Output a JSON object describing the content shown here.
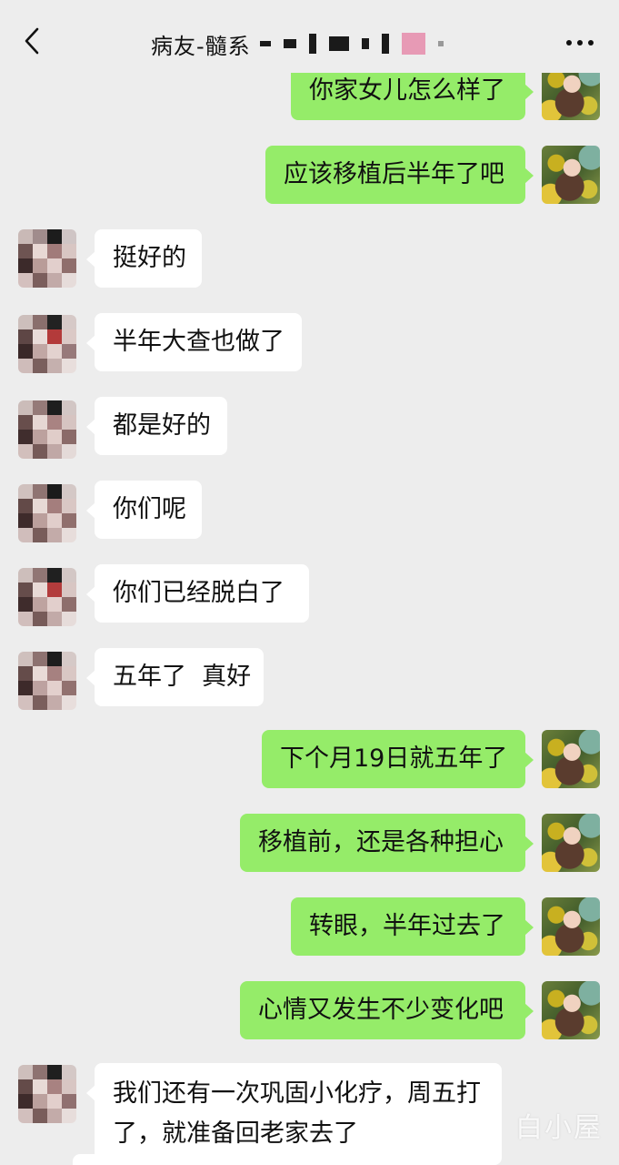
{
  "header": {
    "title": "病友-髓系"
  },
  "messages": [
    {
      "side": "right",
      "text": "你家女儿怎么样了"
    },
    {
      "side": "right",
      "text": "应该移植后半年了吧"
    },
    {
      "side": "left",
      "text": "挺好的"
    },
    {
      "side": "left",
      "text": "半年大查也做了"
    },
    {
      "side": "left",
      "text": "都是好的"
    },
    {
      "side": "left",
      "text": "你们呢"
    },
    {
      "side": "left",
      "text": "你们已经脱白了"
    },
    {
      "side": "left",
      "text": "五年了  真好"
    },
    {
      "side": "right",
      "text": "下个月19日就五年了"
    },
    {
      "side": "right",
      "text": "移植前，还是各种担心"
    },
    {
      "side": "right",
      "text": "转眼，半年过去了"
    },
    {
      "side": "right",
      "text": "心情又发生不少变化吧"
    },
    {
      "side": "left",
      "text": "我们还有一次巩固小化疗，周五打了，就准备回老家去了"
    }
  ],
  "watermark": "白小屋",
  "icons": {
    "back": "chevron-left-icon",
    "more": "more-dots-icon"
  },
  "colors": {
    "background": "#ededed",
    "sent_bubble": "#95ec69",
    "received_bubble": "#ffffff"
  }
}
